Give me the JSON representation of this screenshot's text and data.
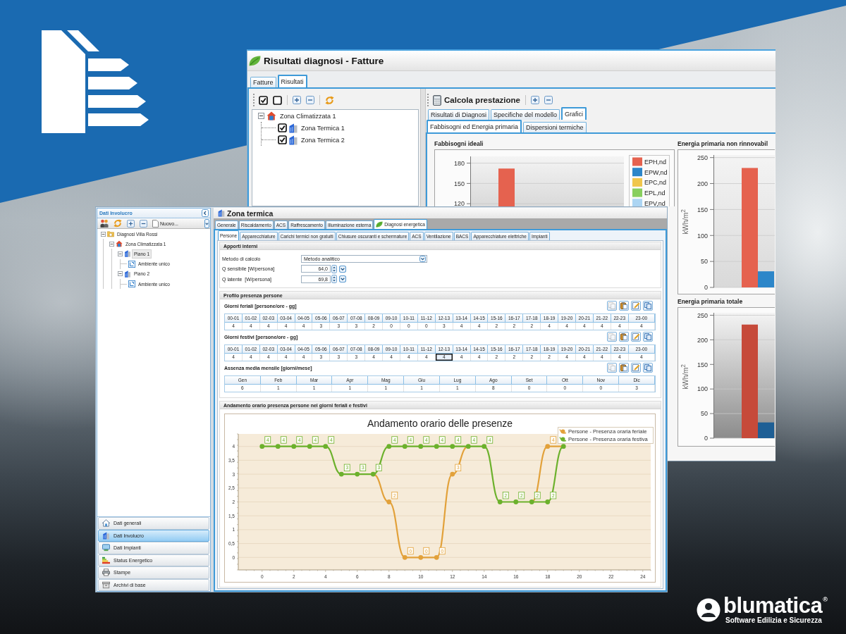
{
  "results_window": {
    "title": "Risultati diagnosi - Fatture",
    "tabs": [
      {
        "label": "Fatture",
        "selected": false
      },
      {
        "label": "Risultati",
        "selected": true
      }
    ],
    "tree": [
      {
        "label": "Zona Climatizzata 1",
        "kind": "zone",
        "expanded": true,
        "selected": false,
        "children": [
          {
            "label": "Zona Termica 1",
            "kind": "thermal",
            "checked": true,
            "selected": false
          },
          {
            "label": "Zona Termica 2",
            "kind": "thermal",
            "checked": true,
            "selected": false
          }
        ]
      }
    ],
    "toolbar_title": "Calcola prestazione",
    "result_tabs": [
      {
        "label": "Risultati di Diagnosi",
        "selected": false
      },
      {
        "label": "Specifiche del modello",
        "selected": false
      },
      {
        "label": "Grafici",
        "selected": true
      }
    ],
    "chart_tabs": [
      {
        "label": "Fabbisogni ed Energia primaria",
        "selected": true
      },
      {
        "label": "Dispersioni termiche",
        "selected": false
      }
    ],
    "charts": [
      {
        "chart_data": {
          "type": "bar",
          "title": "Fabbisogni ideali",
          "ylim": [
            116,
            190
          ],
          "yticks": [
            120,
            150,
            180
          ],
          "grid": true,
          "series": [
            {
              "name": "EPH,nd",
              "color": "#e5624f",
              "values": [
                172
              ]
            },
            {
              "name": "EPW,nd",
              "color": "#2c86c9",
              "values": [
                null
              ]
            },
            {
              "name": "EPC,nd",
              "color": "#f0c64c",
              "values": [
                null
              ]
            },
            {
              "name": "EPL,nd",
              "color": "#88cf5e",
              "values": [
                null
              ]
            },
            {
              "name": "EPV,nd",
              "color": "#acd5f3",
              "values": [
                null
              ]
            }
          ]
        }
      },
      {
        "chart_data": {
          "type": "bar",
          "title": "Energia primaria non rinnovabil",
          "ylabel": "kWh/m$^{2}$",
          "ylim": [
            0,
            255
          ],
          "yticks": [
            0,
            50,
            100,
            150,
            200,
            250
          ],
          "grid": true,
          "series": [
            {
              "color": "#e5624f",
              "values": [
                230
              ]
            },
            {
              "color": "#2c86c9",
              "values": [
                31
              ]
            }
          ]
        }
      },
      {
        "chart_data": {
          "type": "bar",
          "title": "Energia primaria totale",
          "ylabel": "kWh/m$^{2}$",
          "ylim": [
            0,
            255
          ],
          "yticks": [
            0,
            50,
            100,
            150,
            200,
            250
          ],
          "grid": true,
          "series": [
            {
              "color": "#c64a3a",
              "values": [
                231
              ]
            },
            {
              "color": "#1e5f95",
              "values": [
                32
              ]
            }
          ]
        }
      }
    ]
  },
  "side_panel": {
    "title": "Dati Involucro",
    "new_button": "Nuovo...",
    "tree": [
      {
        "label": "Diagnosi Villa Rossi",
        "kind": "project",
        "expanded": true,
        "selected": false,
        "children": [
          {
            "label": "Zona Climatizzata 1",
            "kind": "zone",
            "expanded": true,
            "selected": false,
            "children": [
              {
                "label": "Piano 1",
                "kind": "floor",
                "expanded": true,
                "selected": true,
                "children": [
                  {
                    "label": "Ambiente unico",
                    "kind": "room",
                    "selected": false
                  }
                ]
              },
              {
                "label": "Piano 2",
                "kind": "floor",
                "expanded": true,
                "selected": false,
                "children": [
                  {
                    "label": "Ambiente unico",
                    "kind": "room",
                    "selected": false
                  }
                ]
              }
            ]
          }
        ]
      }
    ],
    "nav": [
      {
        "label": "Dati generali",
        "selected": false
      },
      {
        "label": "Dati Involucro",
        "selected": true
      },
      {
        "label": "Dati Impianti",
        "selected": false
      },
      {
        "label": "Status Energetico",
        "selected": false
      },
      {
        "label": "Stampe",
        "selected": false
      },
      {
        "label": "Archivi di base",
        "selected": false
      }
    ]
  },
  "zone_window": {
    "title": "Zona termica",
    "tabs": [
      {
        "label": "Generale",
        "kind": "plain",
        "selected": false
      },
      {
        "label": "Riscaldamento",
        "kind": "plain",
        "selected": false
      },
      {
        "label": "ACS",
        "kind": "plain",
        "selected": false
      },
      {
        "label": "Raffrescamento",
        "kind": "plain",
        "selected": false
      },
      {
        "label": "Illuminazione esterna",
        "kind": "plain",
        "selected": false
      },
      {
        "label": "Diagnosi energetica",
        "kind": "icon",
        "selected": true
      }
    ],
    "subtabs": [
      {
        "label": "Persone",
        "selected": true
      },
      {
        "label": "Apparecchiature",
        "selected": false
      },
      {
        "label": "Carichi termici non gratuiti",
        "selected": false
      },
      {
        "label": "Chiusure oscuranti e schermature",
        "selected": false
      },
      {
        "label": "ACS",
        "selected": false
      },
      {
        "label": "Ventilazione",
        "selected": false
      },
      {
        "label": "BACS",
        "selected": false
      },
      {
        "label": "Apparecchiature elettriche",
        "selected": false
      },
      {
        "label": "Impianti",
        "selected": false
      }
    ],
    "internal_gains": {
      "title": "Apporti interni",
      "fields": [
        {
          "label": "Metodo di calcolo",
          "kind": "select",
          "value": "Metodo analitico"
        },
        {
          "label": "Q sensibile [W/persona]",
          "kind": "spinner",
          "value": "64,0"
        },
        {
          "label": "Q latente  [W/persona]",
          "kind": "spinner",
          "value": "69,8"
        }
      ]
    },
    "presence_profile": {
      "title": "Profilo presenza persone",
      "tables": [
        {
          "title": "Giorni feriali [persone/ore - gg]",
          "actions": [
            {
              "disabled": true
            },
            {
              "disabled": false
            },
            {
              "disabled": false
            },
            {
              "disabled": false
            }
          ],
          "columns": [
            "00-01",
            "01-02",
            "02-03",
            "03-04",
            "04-05",
            "05-06",
            "06-07",
            "07-08",
            "08-09",
            "09-10",
            "10-11",
            "11-12",
            "12-13",
            "13-14",
            "14-15",
            "15-16",
            "16-17",
            "17-18",
            "18-19",
            "19-20",
            "20-21",
            "21-22",
            "22-23",
            "23-00"
          ],
          "cells": [
            {
              "value": "4",
              "selected": false
            },
            {
              "value": "4",
              "selected": false
            },
            {
              "value": "4",
              "selected": false
            },
            {
              "value": "4",
              "selected": false
            },
            {
              "value": "4",
              "selected": false
            },
            {
              "value": "3",
              "selected": false
            },
            {
              "value": "3",
              "selected": false
            },
            {
              "value": "3",
              "selected": false
            },
            {
              "value": "2",
              "selected": false
            },
            {
              "value": "0",
              "selected": false
            },
            {
              "value": "0",
              "selected": false
            },
            {
              "value": "0",
              "selected": false
            },
            {
              "value": "3",
              "selected": false
            },
            {
              "value": "4",
              "selected": false
            },
            {
              "value": "4",
              "selected": false
            },
            {
              "value": "2",
              "selected": false
            },
            {
              "value": "2",
              "selected": false
            },
            {
              "value": "2",
              "selected": false
            },
            {
              "value": "4",
              "selected": false
            },
            {
              "value": "4",
              "selected": false
            },
            {
              "value": "4",
              "selected": false
            },
            {
              "value": "4",
              "selected": false
            },
            {
              "value": "4",
              "selected": false
            },
            {
              "value": "4",
              "selected": false
            }
          ]
        },
        {
          "title": "Giorni festivi [persone/ore - gg]",
          "actions": [
            {
              "disabled": true
            },
            {
              "disabled": false
            },
            {
              "disabled": false
            },
            {
              "disabled": false
            }
          ],
          "columns": [
            "00-01",
            "01-02",
            "02-03",
            "03-04",
            "04-05",
            "05-06",
            "06-07",
            "07-08",
            "08-09",
            "09-10",
            "10-11",
            "11-12",
            "12-13",
            "13-14",
            "14-15",
            "15-16",
            "16-17",
            "17-18",
            "18-19",
            "19-20",
            "20-21",
            "21-22",
            "22-23",
            "23-00"
          ],
          "cells": [
            {
              "value": "4",
              "selected": false
            },
            {
              "value": "4",
              "selected": false
            },
            {
              "value": "4",
              "selected": false
            },
            {
              "value": "4",
              "selected": false
            },
            {
              "value": "4",
              "selected": false
            },
            {
              "value": "3",
              "selected": false
            },
            {
              "value": "3",
              "selected": false
            },
            {
              "value": "3",
              "selected": false
            },
            {
              "value": "4",
              "selected": false
            },
            {
              "value": "4",
              "selected": false
            },
            {
              "value": "4",
              "selected": false
            },
            {
              "value": "4",
              "selected": false
            },
            {
              "value": "4",
              "selected": true
            },
            {
              "value": "4",
              "selected": false
            },
            {
              "value": "4",
              "selected": false
            },
            {
              "value": "2",
              "selected": false
            },
            {
              "value": "2",
              "selected": false
            },
            {
              "value": "2",
              "selected": false
            },
            {
              "value": "2",
              "selected": false
            },
            {
              "value": "4",
              "selected": false
            },
            {
              "value": "4",
              "selected": false
            },
            {
              "value": "4",
              "selected": false
            },
            {
              "value": "4",
              "selected": false
            },
            {
              "value": "4",
              "selected": false
            }
          ]
        },
        {
          "title": "Assenza media mensile [giorni/mese]",
          "actions": [
            {
              "disabled": true
            },
            {
              "disabled": false
            },
            {
              "disabled": false
            },
            {
              "disabled": false
            }
          ],
          "columns": [
            "Gen",
            "Feb",
            "Mar",
            "Apr",
            "Mag",
            "Giu",
            "Lug",
            "Ago",
            "Set",
            "Ott",
            "Nov",
            "Dic"
          ],
          "cells": [
            {
              "value": "6",
              "selected": false
            },
            {
              "value": "1",
              "selected": false
            },
            {
              "value": "1",
              "selected": false
            },
            {
              "value": "1",
              "selected": false
            },
            {
              "value": "1",
              "selected": false
            },
            {
              "value": "1",
              "selected": false
            },
            {
              "value": "1",
              "selected": false
            },
            {
              "value": "8",
              "selected": false
            },
            {
              "value": "0",
              "selected": false
            },
            {
              "value": "0",
              "selected": false
            },
            {
              "value": "0",
              "selected": false
            },
            {
              "value": "3",
              "selected": false
            }
          ]
        }
      ]
    },
    "hourly_trend": {
      "title": "Andamento orario presenza persone nei giorni feriali e festivi",
      "chart_data": {
        "type": "line",
        "title": "Andamento orario delle presenze",
        "x": [
          0,
          1,
          2,
          3,
          4,
          5,
          6,
          7,
          8,
          9,
          10,
          11,
          12,
          13,
          14,
          15,
          16,
          17,
          18,
          19
        ],
        "series": [
          {
            "name": "Persone - Presenza oraria feriale",
            "color": "#e2a13a",
            "marker": "circle",
            "values": [
              null,
              null,
              null,
              null,
              null,
              null,
              null,
              3,
              2,
              0,
              0,
              0,
              3,
              4,
              null,
              null,
              null,
              2,
              4,
              4
            ],
            "value_labels": [
              null,
              null,
              null,
              null,
              null,
              null,
              null,
              null,
              "2",
              "0",
              "0",
              "0",
              "3",
              null,
              null,
              null,
              null,
              null,
              "4",
              null
            ]
          },
          {
            "name": "Persone - Presenza oraria festiva",
            "color": "#6cb12c",
            "marker": "circle",
            "values": [
              4,
              4,
              4,
              4,
              4,
              3,
              3,
              3,
              4,
              4,
              4,
              4,
              4,
              4,
              4,
              2,
              2,
              2,
              2,
              4
            ],
            "value_labels": [
              "4",
              "4",
              "4",
              "4",
              "4",
              "3",
              "3",
              "3",
              "4",
              "4",
              "4",
              "4",
              "4",
              "4",
              "4",
              "2",
              "2",
              "2",
              "2",
              null
            ]
          }
        ],
        "xlim": [
          -1.5,
          24.5
        ],
        "ylim": [
          -0.45,
          4.45
        ],
        "xticks": [
          0,
          2,
          4,
          6,
          8,
          10,
          12,
          14,
          16,
          18,
          20,
          22,
          24
        ],
        "yticks": [
          0,
          {
            "value": 0.5,
            "label": "0,5"
          },
          1,
          {
            "value": 1.5,
            "label": "1,5"
          },
          2,
          {
            "value": 2.5,
            "label": "2,5"
          },
          3,
          {
            "value": 3.5,
            "label": "3,5"
          },
          4
        ],
        "grid": true,
        "legend": "upper right"
      }
    }
  },
  "brand": {
    "name": "blumatica$^{®}$",
    "tagline": "Software Edilizia e Sicurezza"
  }
}
